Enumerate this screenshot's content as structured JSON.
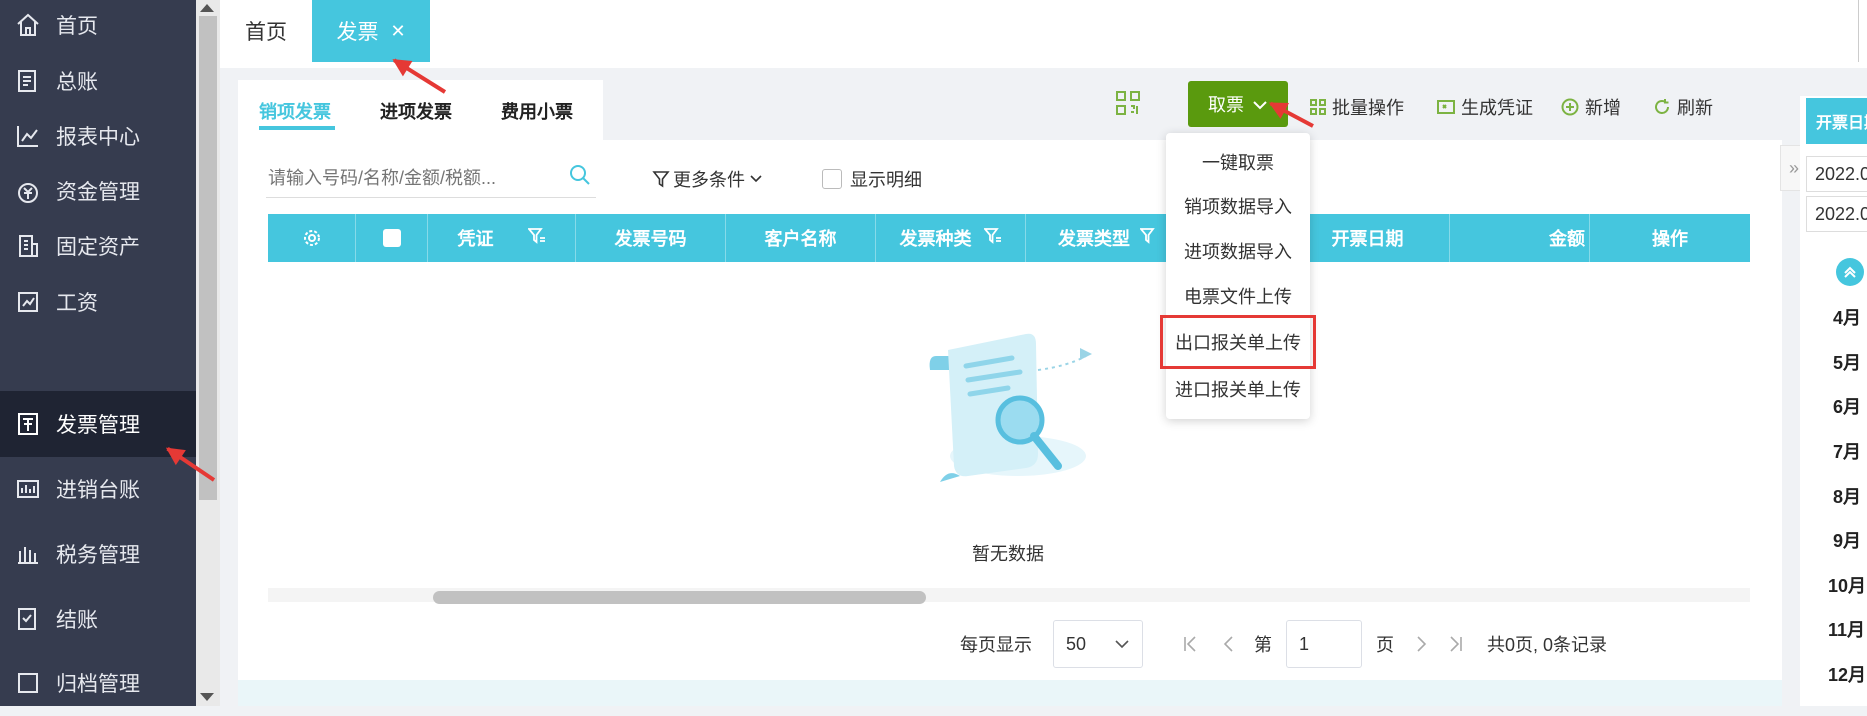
{
  "sidebar": {
    "items": [
      {
        "label": "首页",
        "icon": "home-icon"
      },
      {
        "label": "总账",
        "icon": "ledger-icon"
      },
      {
        "label": "报表中心",
        "icon": "report-chart-icon"
      },
      {
        "label": "资金管理",
        "icon": "yuan-bag-icon"
      },
      {
        "label": "固定资产",
        "icon": "building-icon"
      },
      {
        "label": "工资",
        "icon": "salary-icon"
      },
      {
        "label": "发票管理",
        "icon": "invoice-icon",
        "active": true
      },
      {
        "label": "进销台账",
        "icon": "account-book-icon"
      },
      {
        "label": "税务管理",
        "icon": "tax-icon"
      },
      {
        "label": "结账",
        "icon": "checkout-icon"
      },
      {
        "label": "归档管理",
        "icon": "archive-icon"
      }
    ]
  },
  "tabs": {
    "home": "首页",
    "invoice": "发票",
    "close_icon": "close-icon"
  },
  "subtabs": [
    "销项发票",
    "进项发票",
    "费用小票"
  ],
  "toolbar": {
    "primary": "取票",
    "batch": "批量操作",
    "voucher": "生成凭证",
    "add": "新增",
    "refresh": "刷新"
  },
  "dropdown": {
    "items": [
      "一键取票",
      "销项数据导入",
      "进项数据导入",
      "电票文件上传",
      "出口报关单上传",
      "进口报关单上传"
    ]
  },
  "filters": {
    "search_placeholder": "请输入号码/名称/金额/税额...",
    "more": "更多条件",
    "show_detail": "显示明细"
  },
  "table": {
    "headers": [
      "凭证",
      "发票号码",
      "客户名称",
      "发票种类",
      "发票类型",
      "开票日期",
      "金额",
      "操作"
    ]
  },
  "empty": "暂无数据",
  "pager": {
    "per_page_label": "每页显示",
    "per_page": "50",
    "di": "第",
    "page": "1",
    "ye": "页",
    "summary": "共0页, 0条记录"
  },
  "right": {
    "header": "开票日期",
    "dates": [
      "2022.0",
      "2022.0"
    ],
    "months": [
      "4月",
      "5月",
      "6月",
      "7月",
      "8月",
      "9月",
      "10月",
      "11月",
      "12月"
    ]
  },
  "colors": {
    "sidebar": "#363c4f",
    "accent": "#45c6de",
    "primary": "#5a9a0e",
    "highlight": "#e53935"
  }
}
